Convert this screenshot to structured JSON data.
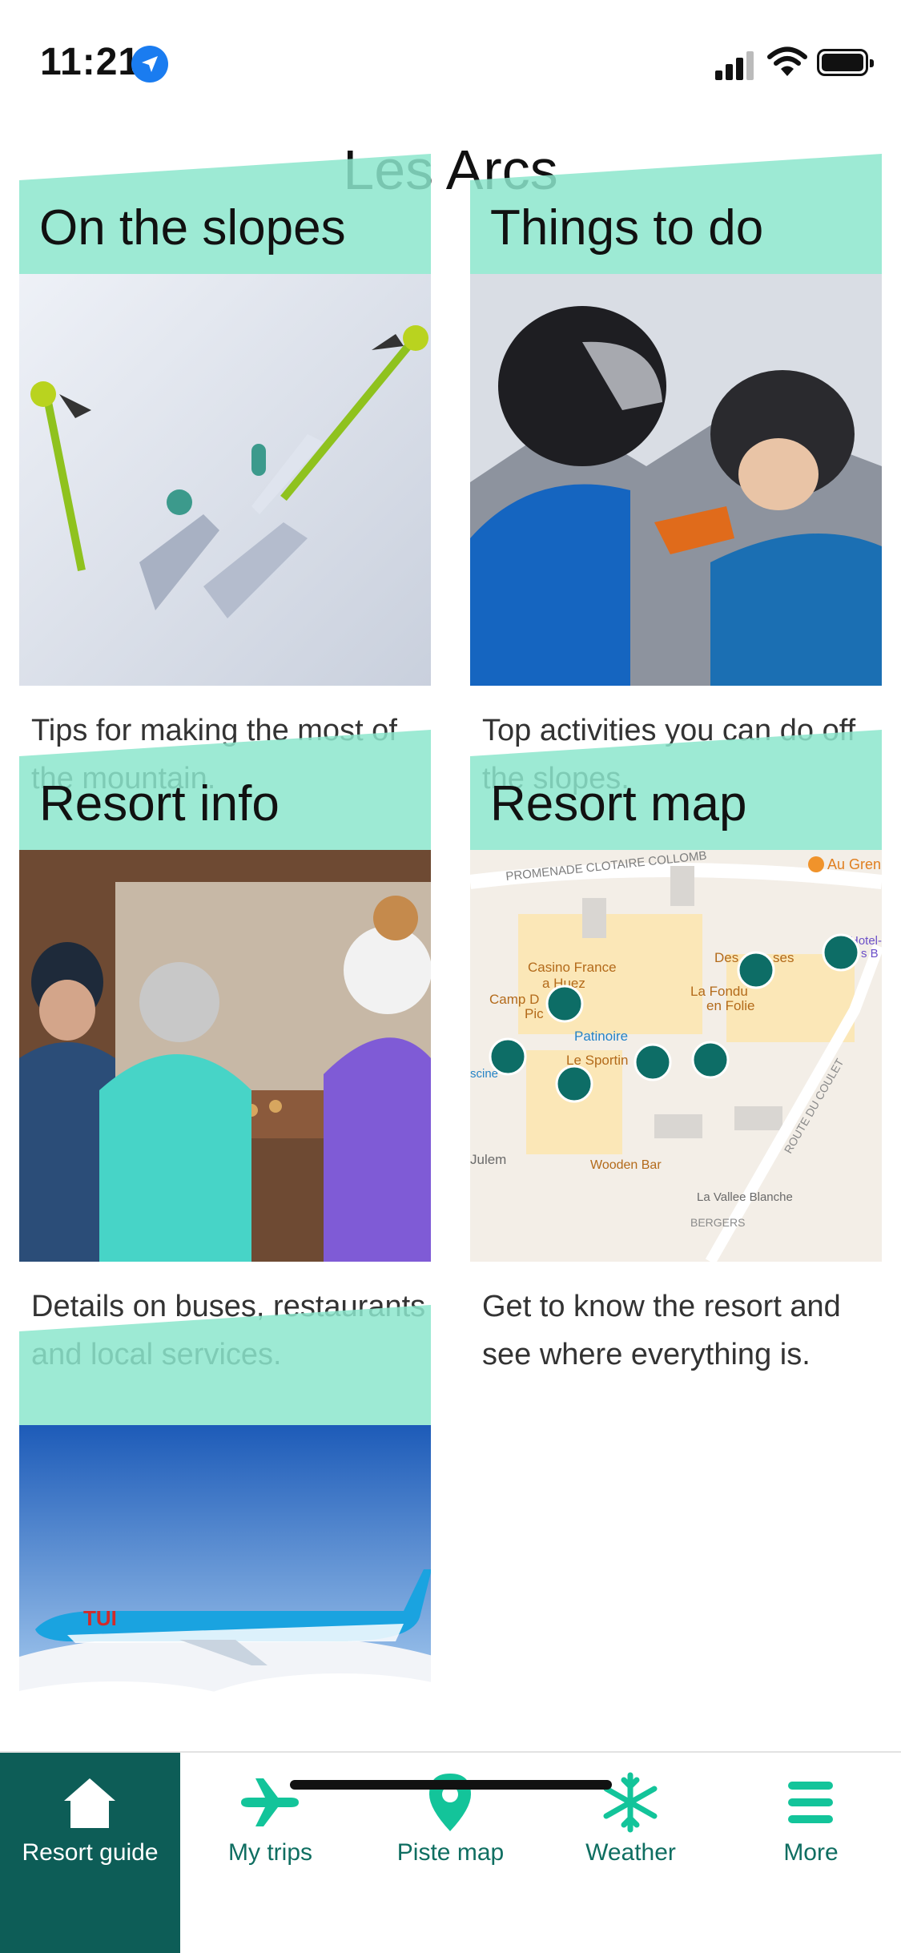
{
  "status_bar": {
    "time": "11:21"
  },
  "page": {
    "title": "Les Arcs"
  },
  "cards": [
    {
      "title": "On the slopes",
      "description": "Tips for making the most of the mountain."
    },
    {
      "title": "Things to do",
      "description": "Top activities you can do off the slopes."
    },
    {
      "title": "Resort info",
      "description": "Details on buses, restaurants and local services."
    },
    {
      "title": "Resort map",
      "description": "Get to know the resort and see where everything is."
    },
    {
      "title": "",
      "description": ""
    }
  ],
  "map_labels": {
    "promenade": "PROMENADE CLOTAIRE COLLOMB",
    "au_gren": "Au Gren",
    "casino": "Casino France",
    "huez": "a Huez",
    "camp": "Camp D",
    "pic": "Pic",
    "patinoire": "Patinoire",
    "sporting": "Le Sportin",
    "fondue": "La Fondu",
    "folie": "en Folie",
    "des": "Des",
    "ses": "ses",
    "route": "ROUTE DU COULET",
    "wooden": "Wooden Bar",
    "vallee": "La Vallee Blanche",
    "jule": "Julem",
    "scine": "scine",
    "bergers": "BERGERS",
    "hotel": "Hotel-",
    "sb": "s B"
  },
  "tabs": [
    {
      "label": "Resort guide",
      "icon": "home-icon",
      "active": true
    },
    {
      "label": "My trips",
      "icon": "airplane-icon",
      "active": false
    },
    {
      "label": "Piste map",
      "icon": "map-pin-icon",
      "active": false
    },
    {
      "label": "Weather",
      "icon": "snowflake-icon",
      "active": false
    },
    {
      "label": "More",
      "icon": "menu-icon",
      "active": false
    }
  ],
  "colors": {
    "accent": "#0d5d57",
    "band": "#8ce6cd",
    "tab_text": "#0f6e61"
  }
}
